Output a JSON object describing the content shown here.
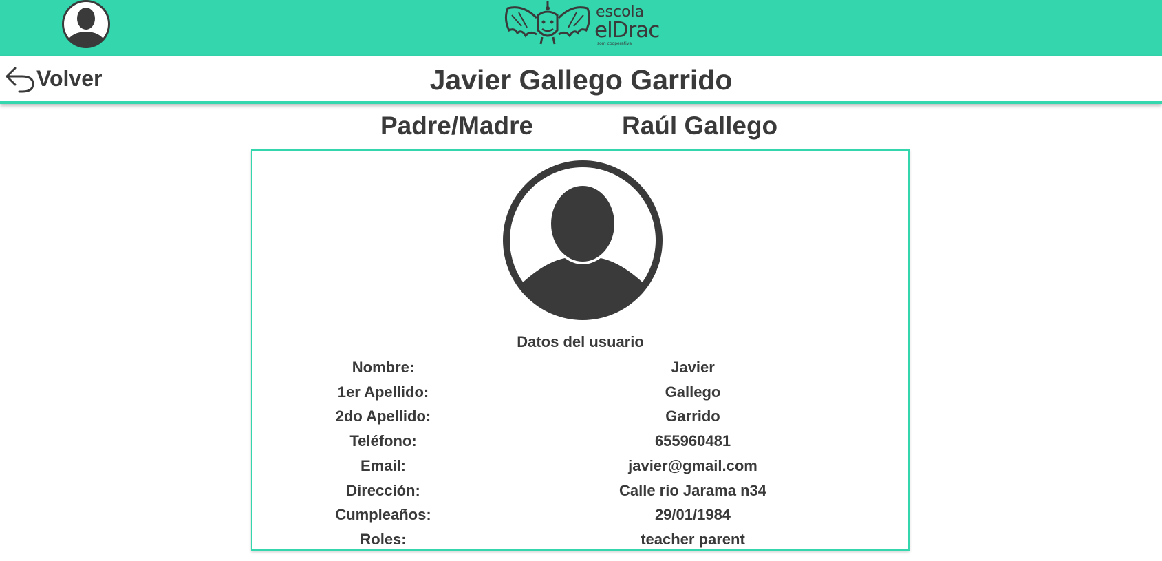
{
  "header": {
    "user_avatar_icon": "user-avatar-icon",
    "logo": {
      "line1": "escola",
      "line2": "elDrac",
      "line3": "som cooperativa"
    },
    "accent_color": "#33d6ad",
    "text_color": "#3a3a3a"
  },
  "subheader": {
    "back_label": "Volver",
    "back_icon": "arrow-back-icon",
    "title": "Javier Gallego Garrido"
  },
  "relation": {
    "label": "Padre/Madre",
    "name": "Raúl Gallego"
  },
  "card": {
    "avatar_icon": "user-avatar-icon",
    "heading": "Datos del usuario",
    "fields": [
      {
        "label": "Nombre:",
        "value": "Javier"
      },
      {
        "label": "1er Apellido:",
        "value": "Gallego"
      },
      {
        "label": "2do Apellido:",
        "value": "Garrido"
      },
      {
        "label": "Teléfono:",
        "value": "655960481"
      },
      {
        "label": "Email:",
        "value": "javier@gmail.com"
      },
      {
        "label": "Dirección:",
        "value": "Calle rio Jarama n34"
      },
      {
        "label": "Cumpleaños:",
        "value": "29/01/1984"
      },
      {
        "label": "Roles:",
        "value": "teacher parent"
      }
    ]
  }
}
